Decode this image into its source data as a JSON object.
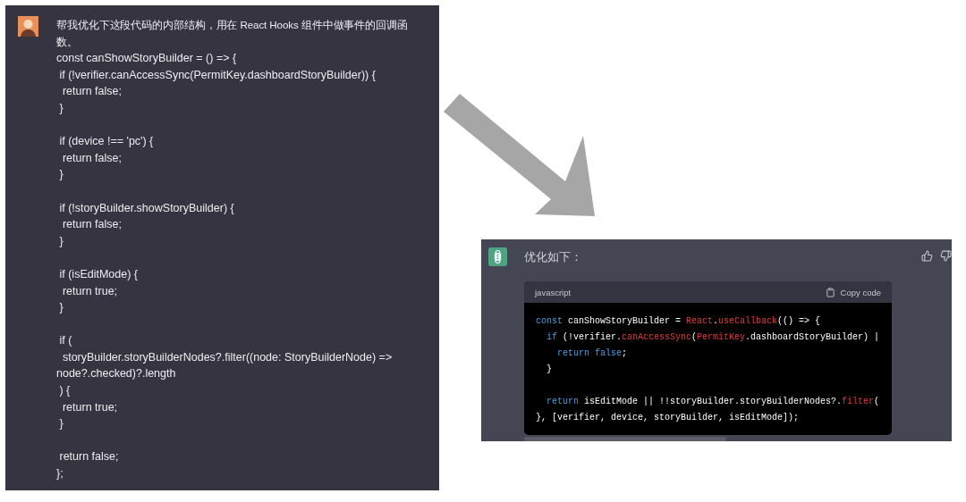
{
  "prompt": {
    "lines": [
      "帮我优化下这段代码的内部结构，用在 React Hooks 组件中做事件的回调函",
      "数。"
    ]
  },
  "user_code": {
    "blocks": [
      [
        "const canShowStoryBuilder = () => {",
        " if (!verifier.canAccessSync(PermitKey.dashboardStoryBuilder)) {",
        "  return false;",
        " }"
      ],
      [
        " if (device !== 'pc') {",
        "  return false;",
        " }"
      ],
      [
        " if (!storyBuilder.showStoryBuilder) {",
        "  return false;",
        " }"
      ],
      [
        " if (isEditMode) {",
        "  return true;",
        " }"
      ],
      [
        " if (",
        "  storyBuilder.storyBuilderNodes?.filter((node: StoryBuilderNode) =>",
        "node?.checked)?.length",
        " ) {",
        "  return true;",
        " }"
      ],
      [
        " return false;",
        "};"
      ]
    ]
  },
  "reply": {
    "text": "优化如下：",
    "code_block": {
      "language": "javascript",
      "copy_label": "Copy code",
      "blocks": [
        [
          [
            {
              "kind": "keyword",
              "text": "const"
            },
            {
              "kind": "plain",
              "text": " canShowStoryBuilder = "
            },
            {
              "kind": "call",
              "text": "React"
            },
            {
              "kind": "plain",
              "text": "."
            },
            {
              "kind": "call",
              "text": "useCallback"
            },
            {
              "kind": "plain",
              "text": "(() => {"
            }
          ],
          [
            {
              "kind": "keyword",
              "text": "  if"
            },
            {
              "kind": "plain",
              "text": " (!verifier."
            },
            {
              "kind": "call",
              "text": "canAccessSync"
            },
            {
              "kind": "plain",
              "text": "("
            },
            {
              "kind": "call",
              "text": "PermitKey"
            },
            {
              "kind": "plain",
              "text": ".dashboardStoryBuilder) |"
            }
          ],
          [
            {
              "kind": "keyword",
              "text": "    return false"
            },
            {
              "kind": "plain",
              "text": ";"
            }
          ],
          [
            {
              "kind": "plain",
              "text": "  }"
            }
          ]
        ],
        [
          [
            {
              "kind": "keyword",
              "text": "  return"
            },
            {
              "kind": "plain",
              "text": " isEditMode || !!storyBuilder.storyBuilderNodes?."
            },
            {
              "kind": "call",
              "text": "filter"
            },
            {
              "kind": "plain",
              "text": "("
            }
          ],
          [
            {
              "kind": "plain",
              "text": "}, [verifier, device, storyBuilder, isEditMode]);"
            }
          ]
        ]
      ]
    }
  }
}
